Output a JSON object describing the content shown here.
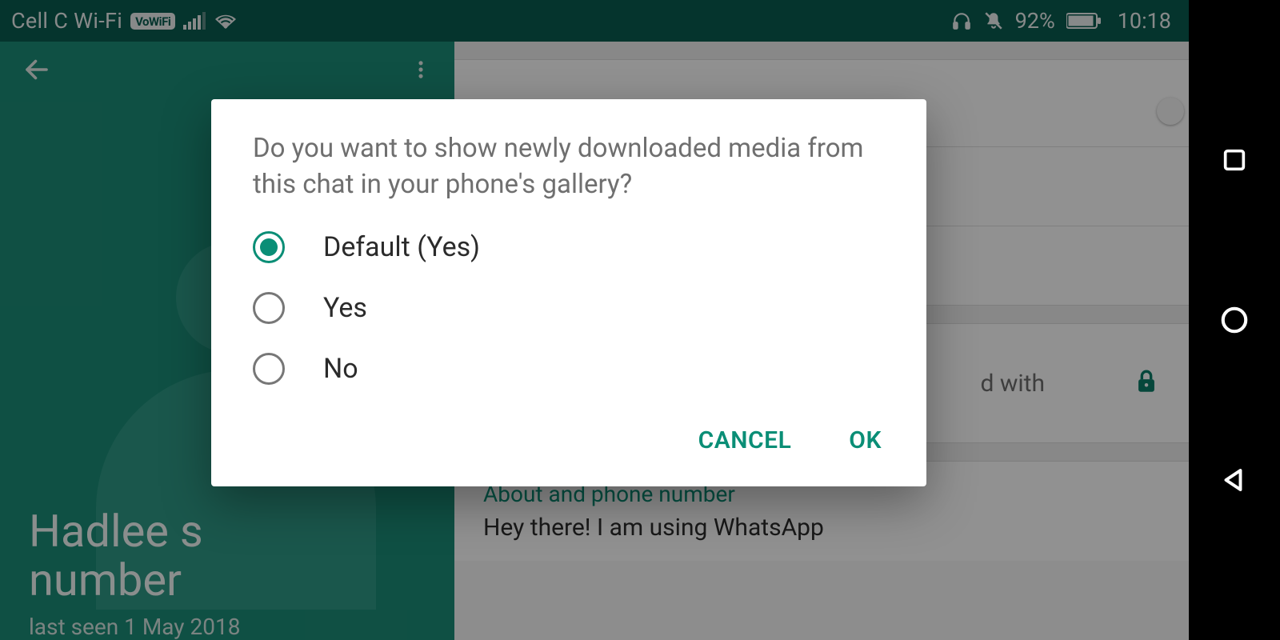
{
  "statusbar": {
    "carrier": "Cell C Wi-Fi",
    "vowifi_badge": "VoWiFi",
    "battery_pct": "92%",
    "clock": "10:18"
  },
  "left_pane": {
    "contact_name_line1": "Hadlee s",
    "contact_name_line2": "number",
    "last_seen": "last seen 1 May 2018"
  },
  "right_pane": {
    "encryption_trail": "d with",
    "section_title": "About and phone number",
    "section_body": "Hey there! I am using WhatsApp"
  },
  "dialog": {
    "title": "Do you want to show newly downloaded media from this chat in your phone's gallery?",
    "options": [
      {
        "label": "Default (Yes)",
        "selected": true
      },
      {
        "label": "Yes",
        "selected": false
      },
      {
        "label": "No",
        "selected": false
      }
    ],
    "cancel": "CANCEL",
    "ok": "OK"
  },
  "colors": {
    "accent": "#0a8e76",
    "statusbar_bg": "#095b4e",
    "header_bg": "#1b8a76"
  }
}
